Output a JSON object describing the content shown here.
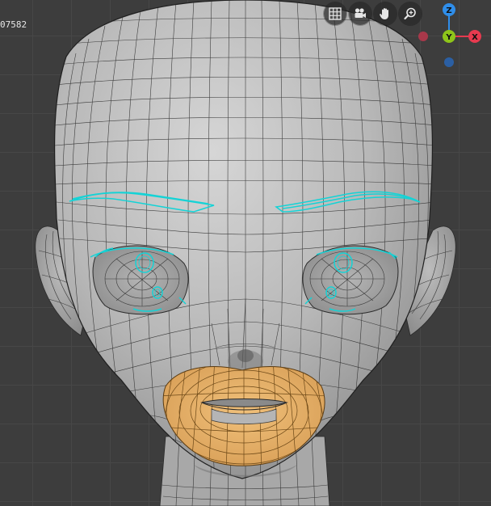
{
  "viewport": {
    "frame_readout": "07582",
    "background_color": "#3d3d3d",
    "grid_color": "#474747"
  },
  "navigation_buttons": [
    {
      "name": "toggle-grid-button",
      "icon": "grid-icon"
    },
    {
      "name": "camera-view-button",
      "icon": "camera-icon"
    },
    {
      "name": "pan-view-button",
      "icon": "hand-icon"
    },
    {
      "name": "zoom-view-button",
      "icon": "zoom-in-icon"
    }
  ],
  "axis_gizmo": {
    "z_label": "Z",
    "y_label": "Y",
    "x_label": "X",
    "colors": {
      "x": "#e63a4f",
      "y": "#8ec51a",
      "z": "#2f8eea",
      "x_neg": "#a8384a",
      "z_neg": "#2b5fa3"
    }
  },
  "model": {
    "mesh_color": "#b9b9b9",
    "wire_color": "#2a2a2a",
    "selection_color": "#f3b45c",
    "edge_highlight_color": "#14d3d6"
  }
}
